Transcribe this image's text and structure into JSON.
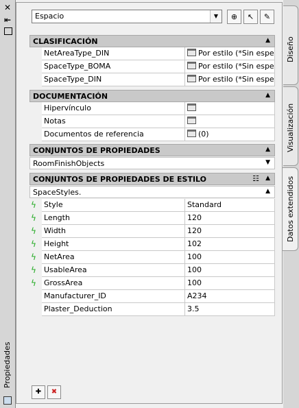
{
  "left_strip": {
    "close_glyph": "✕",
    "autohide_glyph": "⇤",
    "title": "Propiedades"
  },
  "tabs": [
    "Diseño",
    "Visualización",
    "Datos extendidos"
  ],
  "object_select": {
    "value": "Espacio"
  },
  "sections": {
    "clasificacion": {
      "title": "CLASIFICACIÓN",
      "rows": [
        {
          "name": "NetAreaType_DIN",
          "value": "Por estilo (*Sin especificar*)"
        },
        {
          "name": "SpaceType_BOMA",
          "value": "Por estilo (*Sin especificar*)"
        },
        {
          "name": "SpaceType_DIN",
          "value": "Por estilo (*Sin especificar*)"
        }
      ]
    },
    "documentacion": {
      "title": "DOCUMENTACIÓN",
      "rows": [
        {
          "name": "Hipervínculo",
          "value": ""
        },
        {
          "name": "Notas",
          "value": ""
        },
        {
          "name": "Documentos de referencia",
          "value": "(0)"
        }
      ]
    },
    "conjuntos": {
      "title": "CONJUNTOS DE PROPIEDADES",
      "sub": "RoomFinishObjects"
    },
    "conjuntos_estilo": {
      "title": "CONJUNTOS DE PROPIEDADES DE ESTILO",
      "sub": "SpaceStyles.",
      "rows": [
        {
          "name": "Style",
          "value": "Standard",
          "auto": true
        },
        {
          "name": "Length",
          "value": "120",
          "auto": true
        },
        {
          "name": "Width",
          "value": "120",
          "auto": true
        },
        {
          "name": "Height",
          "value": "102",
          "auto": true
        },
        {
          "name": "NetArea",
          "value": "100",
          "auto": true
        },
        {
          "name": "UsableArea",
          "value": "100",
          "auto": true
        },
        {
          "name": "GrossArea",
          "value": "100",
          "auto": true
        },
        {
          "name": "Manufacturer_ID",
          "value": "A234",
          "auto": false
        },
        {
          "name": "Plaster_Deduction",
          "value": "3.5",
          "auto": false
        }
      ]
    }
  },
  "icons": {
    "calendar": "property-editor-icon",
    "auto_prop": "automatic-property-icon",
    "colors": {
      "header_bg": "#c9c9c9",
      "auto_icon": "#22aa22"
    }
  }
}
